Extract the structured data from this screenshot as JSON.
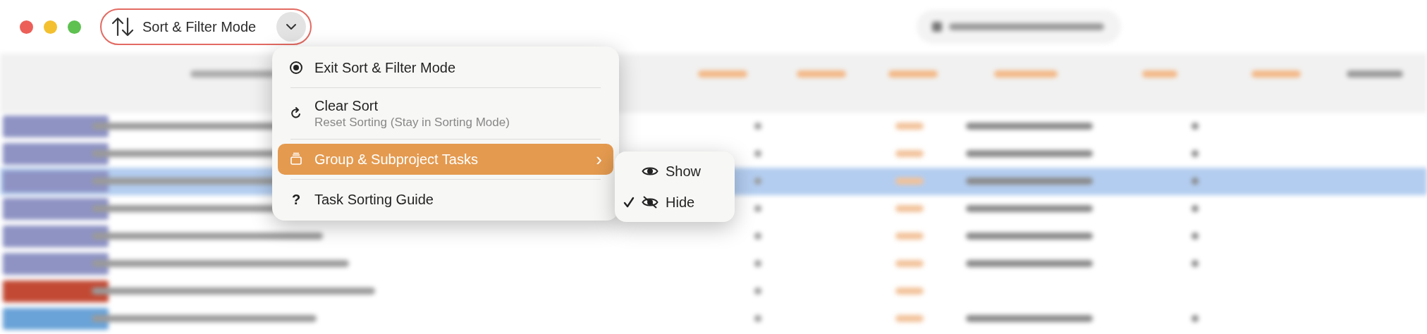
{
  "toolbar": {
    "sort_button": {
      "label": "Sort & Filter Mode"
    }
  },
  "menu": {
    "items": [
      {
        "kind": "action",
        "label": "Exit Sort & Filter Mode"
      },
      {
        "kind": "subtitled",
        "label": "Clear Sort",
        "subtitle": "Reset Sorting (Stay in Sorting Mode)"
      },
      {
        "kind": "submenu",
        "label": "Group & Subproject Tasks",
        "selected": true,
        "arrow": "›"
      },
      {
        "kind": "help",
        "icon": "?",
        "label": "Task Sorting Guide"
      }
    ]
  },
  "submenu": {
    "items": [
      {
        "label": "Show",
        "checked": false
      },
      {
        "label": "Hide",
        "checked": true
      }
    ]
  }
}
